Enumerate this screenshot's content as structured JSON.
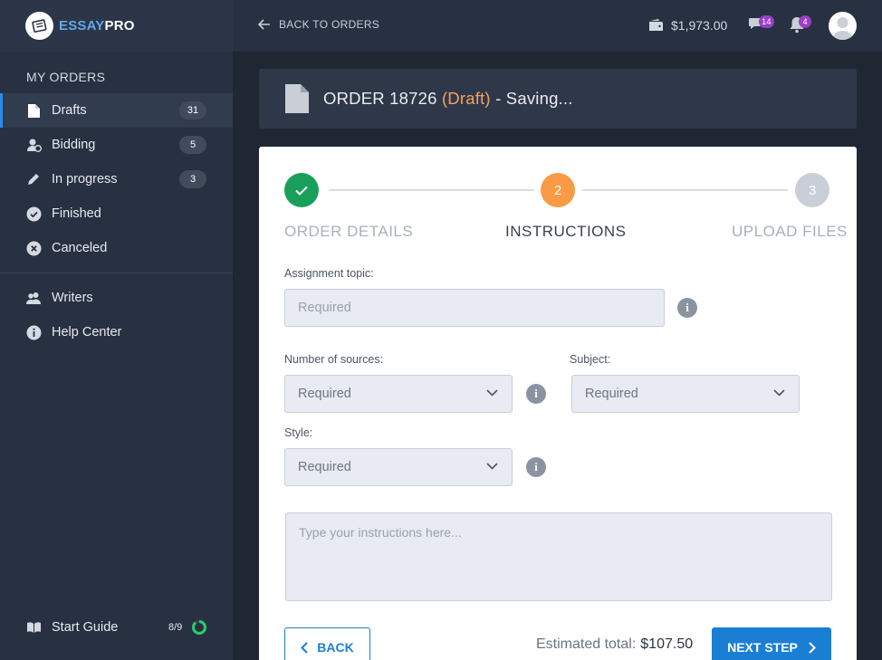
{
  "brand": {
    "name_part1": "ESSAY",
    "name_part2": "PRO"
  },
  "sidebar": {
    "section_title": "MY ORDERS",
    "orders": [
      {
        "label": "Drafts",
        "badge": "31",
        "icon": "document-icon",
        "active": true
      },
      {
        "label": "Bidding",
        "badge": "5",
        "icon": "bidding-icon"
      },
      {
        "label": "In progress",
        "badge": "3",
        "icon": "pencil-icon"
      },
      {
        "label": "Finished",
        "icon": "check-circle-icon"
      },
      {
        "label": "Canceled",
        "icon": "x-circle-icon"
      }
    ],
    "secondary": [
      {
        "label": "Writers",
        "icon": "users-icon"
      },
      {
        "label": "Help Center",
        "icon": "info-circle-icon"
      }
    ],
    "start_guide": {
      "label": "Start Guide",
      "progress_text": "8/9",
      "progress": 0.889
    }
  },
  "topbar": {
    "back_label": "BACK TO ORDERS",
    "balance": "$1,973.00",
    "messages_count": "14",
    "notifications_count": "4"
  },
  "order": {
    "title_prefix": "ORDER 18726",
    "status": "(Draft)",
    "status_suffix": "- Saving..."
  },
  "steps": [
    {
      "number": "✓",
      "label": "ORDER DETAILS",
      "state": "done"
    },
    {
      "number": "2",
      "label": "INSTRUCTIONS",
      "state": "current"
    },
    {
      "number": "3",
      "label": "UPLOAD FILES",
      "state": "pending"
    }
  ],
  "form": {
    "topic_label": "Assignment topic:",
    "topic_placeholder": "Required",
    "sources_label": "Number of sources:",
    "sources_value": "Required",
    "subject_label": "Subject:",
    "subject_value": "Required",
    "style_label": "Style:",
    "style_value": "Required",
    "instructions_placeholder": "Type your instructions here..."
  },
  "footer": {
    "back_label": "BACK",
    "estimate_label": "Estimated total:",
    "estimate_value": "$107.50",
    "next_label": "NEXT STEP"
  },
  "colors": {
    "accent": "#1a7fd4",
    "done": "#18a05a",
    "current": "#f89a46",
    "pending": "#c9cfd9",
    "draft": "#f4a05a",
    "badge_purple": "#9b3dc7"
  }
}
